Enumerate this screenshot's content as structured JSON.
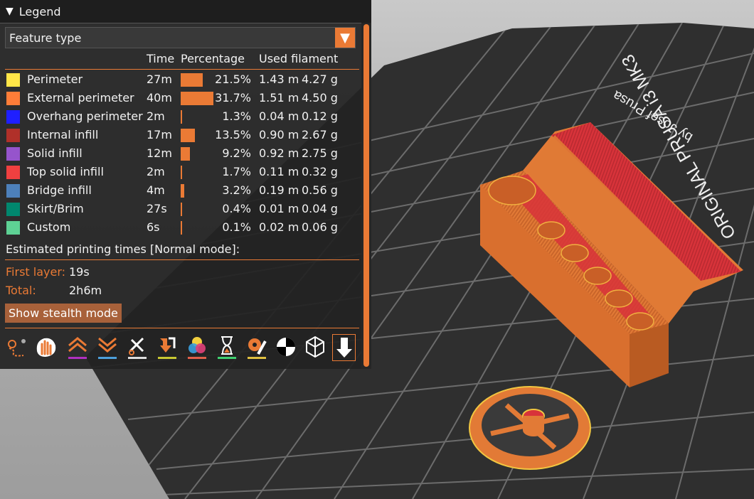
{
  "legend": {
    "title": "Legend",
    "view_type": "Feature type",
    "columns": {
      "time": "Time",
      "percentage": "Percentage",
      "used_filament": "Used filament"
    },
    "rows": [
      {
        "name": "Perimeter",
        "time": "27m",
        "percent": "21.5%",
        "length": "1.43 m",
        "weight": "4.27 g",
        "color": "#FFE648",
        "share": 0.215
      },
      {
        "name": "External perimeter",
        "time": "40m",
        "percent": "31.7%",
        "length": "1.51 m",
        "weight": "4.50 g",
        "color": "#FF7D38",
        "share": 0.317
      },
      {
        "name": "Overhang perimeter",
        "time": "2m",
        "percent": "1.3%",
        "length": "0.04 m",
        "weight": "0.12 g",
        "color": "#1F1FFF",
        "share": 0.013
      },
      {
        "name": "Internal infill",
        "time": "17m",
        "percent": "13.5%",
        "length": "0.90 m",
        "weight": "2.67 g",
        "color": "#B03029",
        "share": 0.135
      },
      {
        "name": "Solid infill",
        "time": "12m",
        "percent": "9.2%",
        "length": "0.92 m",
        "weight": "2.75 g",
        "color": "#9654CC",
        "share": 0.092
      },
      {
        "name": "Top solid infill",
        "time": "2m",
        "percent": "1.7%",
        "length": "0.11 m",
        "weight": "0.32 g",
        "color": "#F04040",
        "share": 0.017
      },
      {
        "name": "Bridge infill",
        "time": "4m",
        "percent": "3.2%",
        "length": "0.19 m",
        "weight": "0.56 g",
        "color": "#4D80BA",
        "share": 0.032
      },
      {
        "name": "Skirt/Brim",
        "time": "27s",
        "percent": "0.4%",
        "length": "0.01 m",
        "weight": "0.04 g",
        "color": "#00876E",
        "share": 0.004
      },
      {
        "name": "Custom",
        "time": "6s",
        "percent": "0.1%",
        "length": "0.02 m",
        "weight": "0.06 g",
        "color": "#5ED194",
        "share": 0.001
      }
    ],
    "estimated_label": "Estimated printing times [Normal mode]:",
    "first_layer_label": "First layer:",
    "first_layer_value": "19s",
    "total_label": "Total:",
    "total_value": "2h6m",
    "stealth_button": "Show stealth mode"
  },
  "toolbar": [
    {
      "id": "travel",
      "icon": "travel-icon",
      "accent": ""
    },
    {
      "id": "wipe",
      "icon": "wipe-hand-icon",
      "accent": ""
    },
    {
      "id": "retractions",
      "icon": "retractions-icon",
      "accent": "#B030C0"
    },
    {
      "id": "deretractions",
      "icon": "deretractions-icon",
      "accent": "#4D9FDB"
    },
    {
      "id": "seams",
      "icon": "seams-icon",
      "accent": "#DDDDDD"
    },
    {
      "id": "tool-changes",
      "icon": "tool-changes-icon",
      "accent": "#C8C832"
    },
    {
      "id": "color-changes",
      "icon": "color-changes-icon",
      "accent": "#E0604A"
    },
    {
      "id": "pause",
      "icon": "pause-icon",
      "accent": "#40D070"
    },
    {
      "id": "custom-gcodes",
      "icon": "custom-gcode-icon",
      "accent": "#E0C040"
    },
    {
      "id": "center-of-gravity",
      "icon": "center-of-gravity-icon",
      "accent": ""
    },
    {
      "id": "shells",
      "icon": "shells-icon",
      "accent": ""
    },
    {
      "id": "tool-marker",
      "icon": "tool-marker-icon",
      "accent": ""
    }
  ],
  "bed": {
    "label_model": "ORIGINAL PRUSA i3 MK3",
    "label_by": "by Josef Prusa"
  },
  "colors": {
    "accent": "#EA7A35",
    "panel": "#222222",
    "object": "#E27A36",
    "top": "#D8333A"
  }
}
